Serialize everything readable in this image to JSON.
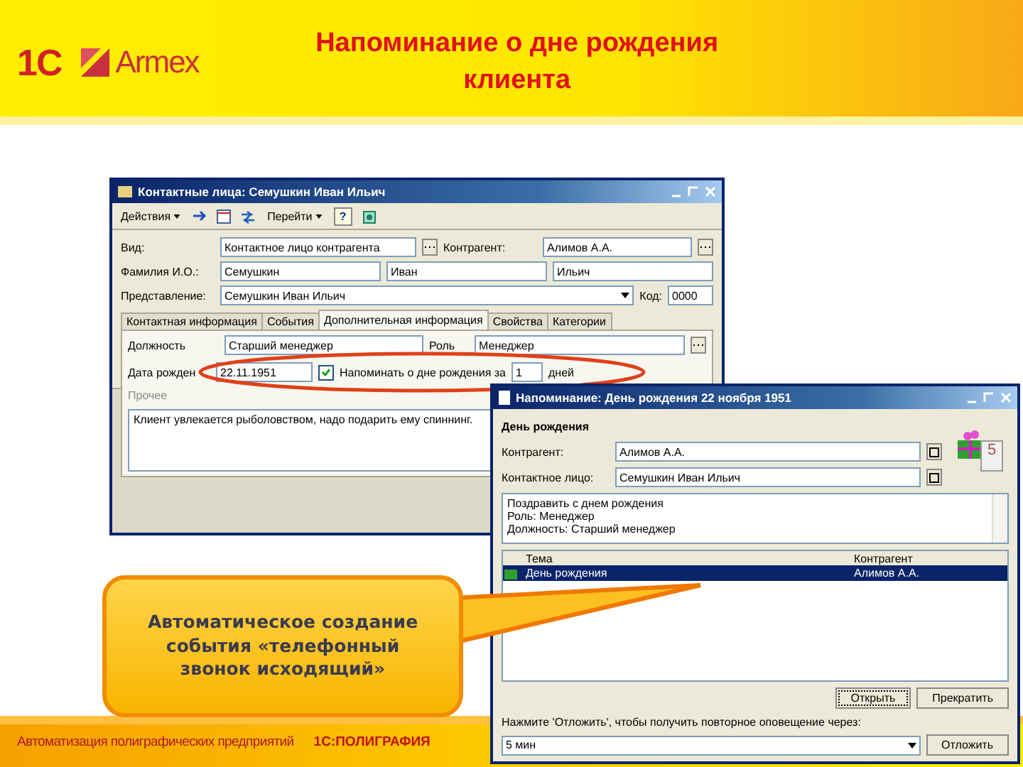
{
  "header": {
    "logos": [
      "1С",
      "Armex"
    ],
    "title": "Напоминание о дне рождения клиента"
  },
  "contact_window": {
    "title": "Контактные лица: Семушкин Иван Ильич",
    "toolbar": [
      {
        "kind": "menu",
        "label": "Действия"
      },
      {
        "kind": "icon"
      },
      {
        "kind": "icon"
      },
      {
        "kind": "icon"
      },
      {
        "kind": "menu",
        "label": "Перейти"
      },
      {
        "kind": "help",
        "label": "?"
      },
      {
        "kind": "icon"
      }
    ],
    "kind_label": "Вид:",
    "kind_value": "Контактное лицо контрагента",
    "counterparty_label": "Контрагент:",
    "counterparty_value": "Алимов А.А.",
    "name_label": "Фамилия И.О.:",
    "name_parts": [
      "Семушкин",
      "Иван",
      "Ильич"
    ],
    "presentation_label": "Представление:",
    "presentation_value": "Семушкин Иван Ильич",
    "code_label": "Код:",
    "code_value": "0000",
    "tabs": [
      {
        "label": "Контактная информация",
        "selected": false
      },
      {
        "label": "События",
        "selected": false
      },
      {
        "label": "Дополнительная информация",
        "selected": true
      },
      {
        "label": "Свойства",
        "selected": false
      },
      {
        "label": "Категории",
        "selected": false
      }
    ],
    "position_label": "Должность",
    "position_value": "Старший менеджер",
    "role_label": "Роль",
    "role_value": "Менеджер",
    "birth_label": "Дата рожден",
    "birth_value": "22.11.1951",
    "remind": {
      "checked": true,
      "label": "Напоминать о дне рождения за",
      "days": "1",
      "unit": "дней"
    },
    "other_title": "Прочее",
    "other_text": "Клиент увлекается рыболовством, надо подарить ему спиннинг."
  },
  "reminder_window": {
    "title": "Напоминание: День рождения 22 ноября 1951",
    "heading": "День рождения",
    "calendar_day": "5",
    "counterparty_label": "Контрагент:",
    "counterparty_value": "Алимов А.А.",
    "contact_label": "Контактное лицо:",
    "contact_value": "Семушкин Иван Ильич",
    "memo": [
      "Поздравить с днем рождения",
      "Роль: Менеджер",
      "Должность: Старший менеджер"
    ],
    "columns": [
      "Тема",
      "Контрагент"
    ],
    "rows": [
      {
        "cells": [
          "День рождения",
          "Алимов А.А."
        ],
        "selected": true
      }
    ],
    "buttons": [
      "Открыть",
      "Прекратить"
    ],
    "snooze_hint": "Нажмите 'Отложить', чтобы получить повторное оповещение через:",
    "snooze_value": "5 мин",
    "snooze_button": "Отложить"
  },
  "callout": {
    "text": "Автоматическое создание события «телефонный звонок исходящий»"
  },
  "footer": {
    "tagline": "Автоматизация полиграфических предприятий",
    "product": "1С:ПОЛИГРАФИЯ"
  }
}
